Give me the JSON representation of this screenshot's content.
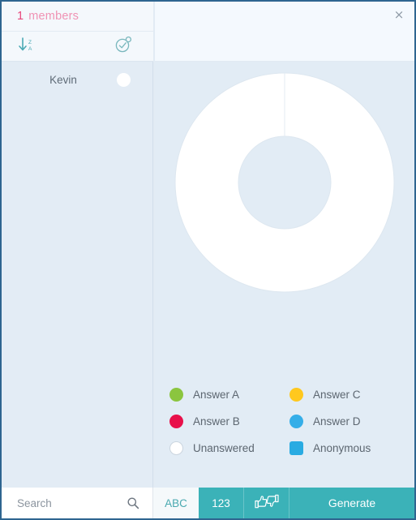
{
  "sidebar": {
    "header": {
      "count": "1",
      "label": "members"
    },
    "toolbar": {
      "sort_icon": "sort-descending-za-icon",
      "select_icon": "check-circle-badge-icon"
    },
    "members": [
      {
        "name": "Kevin",
        "status_icon": "status-dot-unanswered"
      }
    ]
  },
  "header": {
    "close_icon": "close-icon",
    "close_label": "×"
  },
  "chart_data": {
    "type": "pie",
    "variant": "donut",
    "title": "",
    "categories": [
      "Answer A",
      "Answer B",
      "Answer C",
      "Answer D",
      "Unanswered"
    ],
    "values": [
      0,
      0,
      0,
      0,
      1
    ],
    "percentages": [
      0,
      0,
      0,
      0,
      100
    ],
    "colors": [
      "#8bc53f",
      "#e8104a",
      "#ffc81e",
      "#35aee8",
      "#ffffff"
    ],
    "start_angle_deg": 0,
    "hole_ratio": 0.42,
    "legend_position": "bottom",
    "grid": false
  },
  "legend": {
    "items": [
      {
        "label": "Answer A",
        "color": "#8bc53f",
        "shape": "circle",
        "name": "legend-answer-a"
      },
      {
        "label": "Answer C",
        "color": "#ffc81e",
        "shape": "circle",
        "name": "legend-answer-c"
      },
      {
        "label": "Answer B",
        "color": "#e8104a",
        "shape": "circle",
        "name": "legend-answer-b"
      },
      {
        "label": "Answer D",
        "color": "#35aee8",
        "shape": "circle",
        "name": "legend-answer-d"
      },
      {
        "label": "Unanswered",
        "color": "#ffffff",
        "shape": "hollow",
        "name": "legend-unanswered"
      },
      {
        "label": "Anonymous",
        "color": "#29abe2",
        "shape": "square",
        "name": "legend-anonymous"
      }
    ]
  },
  "bottom_bar": {
    "search_placeholder": "Search",
    "search_value": "",
    "search_icon": "search-icon",
    "abc_label": "ABC",
    "numeric_label": "123",
    "vote_icon": "thumbs-up-down-icon",
    "generate_label": "Generate"
  },
  "colors": {
    "accent_teal": "#3bb2b8",
    "accent_pink": "#e8477c",
    "page_background": "#e2ecf5",
    "window_border": "#2e6590"
  }
}
